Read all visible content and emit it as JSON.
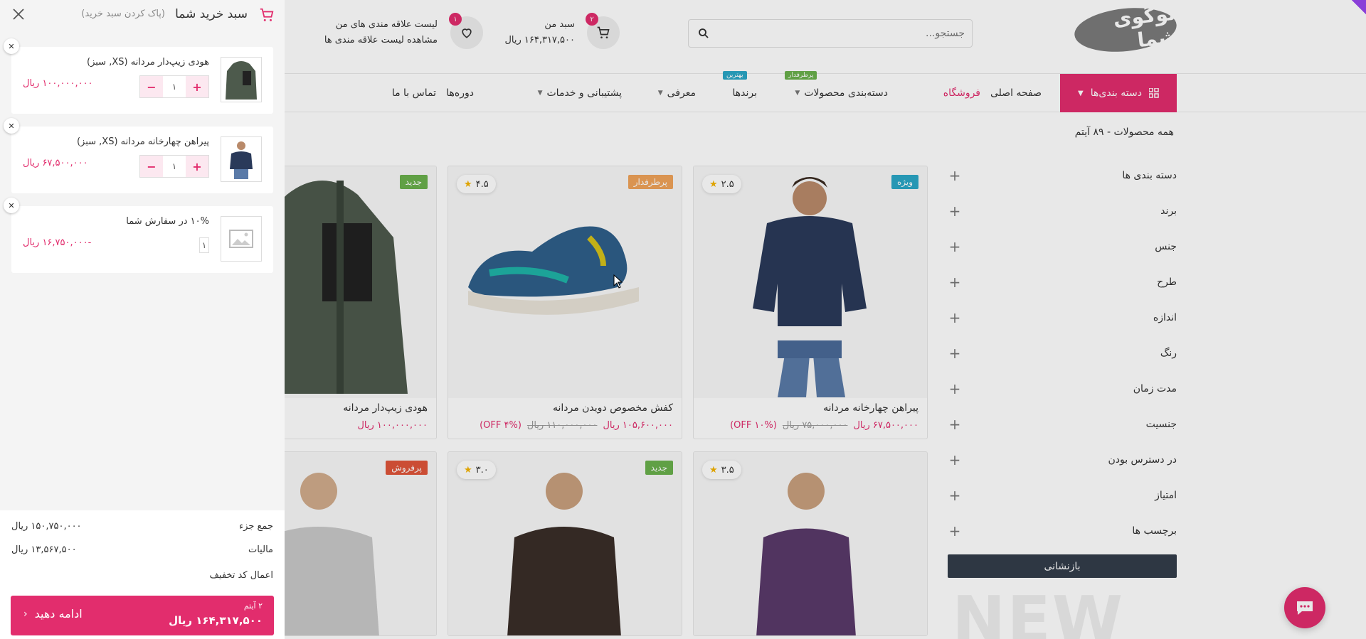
{
  "colors": {
    "accent": "#e22d6d",
    "dark": "#333d4a",
    "new_tag": "#6ab04c",
    "special_tag": "#2aa6c6",
    "popular_tag": "#f0a35a",
    "best_tag": "#e0553a"
  },
  "header": {
    "logo_text": "لوگوی شما",
    "search_placeholder": "جستجو...",
    "cart_label": "سبد من",
    "cart_total": "۱۶۴,۳۱۷,۵۰۰ ریال",
    "cart_count": "۲",
    "wishlist_label": "لیست علاقه مندی های من",
    "wishlist_sub": "مشاهده لیست علاقه مندی ها",
    "wishlist_count": "۱"
  },
  "nav": {
    "categories": "دسته بندی‌ها",
    "home": "صفحه اصلی",
    "shop": "فروشگاه",
    "product_categories": "دسته‌بندی محصولات",
    "product_categories_tag": "پرطرفدار",
    "brands": "برندها",
    "brands_tag": "بهترین",
    "intro": "معرفی",
    "support": "پشتیبانی و خدمات",
    "courses": "دوره‌ها",
    "contact": "تماس با ما"
  },
  "breadcrumb": "همه محصولات - ۸۹ آیتم",
  "filters": [
    "دسته بندی ها",
    "برند",
    "جنس",
    "طرح",
    "اندازه",
    "رنگ",
    "مدت زمان",
    "جنسیت",
    "در دسترس بودن",
    "امتیاز",
    "برچسب ها"
  ],
  "reset_label": "بازنشانی",
  "new_watermark": "NEW",
  "products": [
    {
      "title": "پیراهن چهارخانه مردانه",
      "tag": "ویژه",
      "rating": "۲.۵",
      "price": "۶۷,۵۰۰,۰۰۰ ریال",
      "old_price": "۷۵,۰۰۰,۰۰۰ ریال",
      "off": "(۱۰% OFF)"
    },
    {
      "title": "کفش مخصوص دویدن مردانه",
      "tag": "پرطرفدار",
      "rating": "۴.۵",
      "price": "۱۰۵,۶۰۰,۰۰۰ ریال",
      "old_price": "۱۱۰,۰۰۰,۰۰۰ ریال",
      "off": "(۴% OFF)"
    },
    {
      "title": "هودی زیپ‌دار مردانه",
      "tag": "جدید",
      "price": "۱۰۰,۰۰۰,۰۰۰ ریال"
    }
  ],
  "products_row2": [
    {
      "rating": "۳.۵"
    },
    {
      "tag": "جدید",
      "rating": "۳.۰"
    },
    {
      "tag": "پرفروش"
    }
  ],
  "drawer": {
    "title": "سبد خرید شما",
    "clear": "(پاک کردن سبد خرید)",
    "items": [
      {
        "name": "هودی زیپ‌دار مردانه (XS, سبز)",
        "qty": "۱",
        "price": "۱۰۰,۰۰۰,۰۰۰ ریال"
      },
      {
        "name": "پیراهن چهارخانه مردانه (XS, سبز)",
        "qty": "۱",
        "price": "۶۷,۵۰۰,۰۰۰ ریال"
      },
      {
        "name": "۱۰% در سفارش شما",
        "qty": "۱",
        "price": "-۱۶,۷۵۰,۰۰۰ ریال"
      }
    ],
    "subtotal_label": "جمع جزء",
    "subtotal": "۱۵۰,۷۵۰,۰۰۰ ریال",
    "tax_label": "مالیات",
    "tax": "۱۳,۵۶۷,۵۰۰ ریال",
    "coupon_label": "اعمال کد تخفیف",
    "checkout_count": "۲ آیتم",
    "checkout_total": "۱۶۴,۳۱۷,۵۰۰ ریال",
    "checkout_label": "ادامه دهید"
  }
}
